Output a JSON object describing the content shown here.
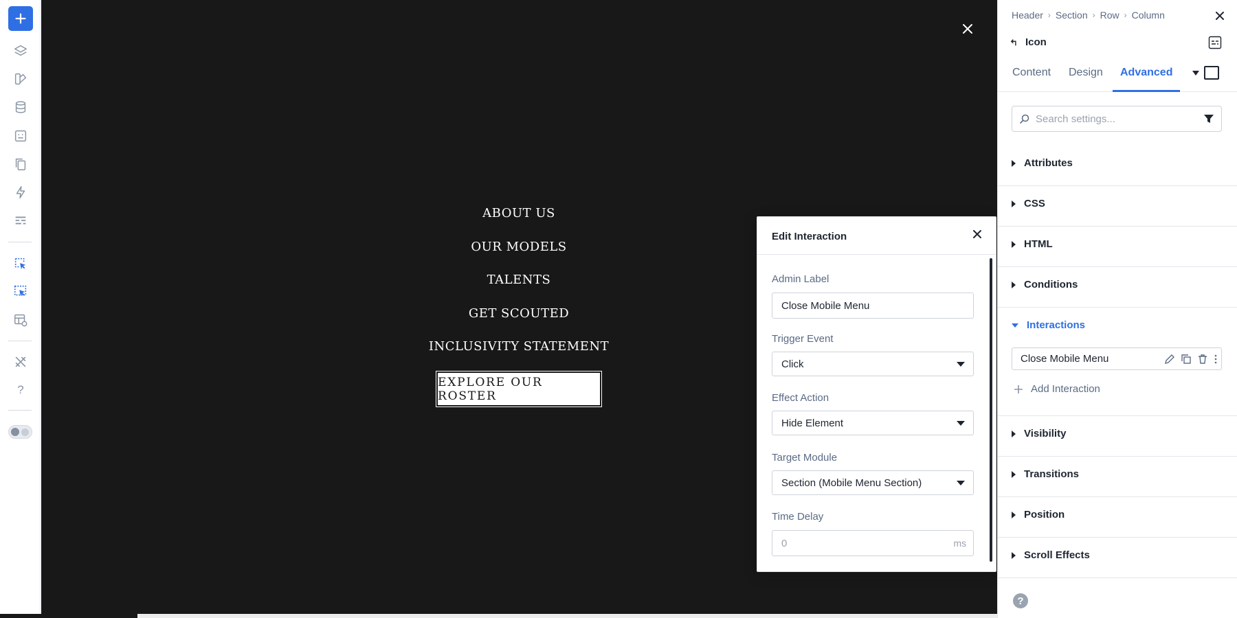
{
  "toolbar": {
    "items": [
      "add",
      "layers",
      "theme-builder",
      "database",
      "pages",
      "copy",
      "lightning",
      "forms",
      "interactions",
      "interactions-active",
      "preview",
      "tools",
      "help",
      "theme-toggle"
    ],
    "help_glyph": "?"
  },
  "canvas": {
    "menu_items": [
      "ABOUT US",
      "OUR MODELS",
      "TALENTS",
      "GET SCOUTED",
      "INCLUSIVITY STATEMENT"
    ],
    "cta_label": "EXPLORE OUR ROSTER",
    "background": "#181818"
  },
  "modal": {
    "title": "Edit Interaction",
    "admin_label": {
      "label": "Admin Label",
      "value": "Close Mobile Menu"
    },
    "trigger_event": {
      "label": "Trigger Event",
      "value": "Click"
    },
    "effect_action": {
      "label": "Effect Action",
      "value": "Hide Element"
    },
    "target_module": {
      "label": "Target Module",
      "value": "Section (Mobile Menu Section)"
    },
    "time_delay": {
      "label": "Time Delay",
      "placeholder": "0",
      "unit": "ms"
    }
  },
  "panel": {
    "breadcrumb": [
      "Header",
      "Section",
      "Row",
      "Column"
    ],
    "module_name": "Icon",
    "tabs": [
      "Content",
      "Design",
      "Advanced"
    ],
    "active_tab": "Advanced",
    "search_placeholder": "Search settings...",
    "groups": [
      "Attributes",
      "CSS",
      "HTML",
      "Conditions",
      "Interactions",
      "Visibility",
      "Transitions",
      "Position",
      "Scroll Effects"
    ],
    "expanded_group": "Interactions",
    "interaction_items": [
      "Close Mobile Menu"
    ],
    "add_interaction_label": "Add Interaction",
    "help_glyph": "?"
  },
  "colors": {
    "accent": "#2f6fe4",
    "text_dark": "#1e2530",
    "text_muted": "#5a6b84"
  }
}
